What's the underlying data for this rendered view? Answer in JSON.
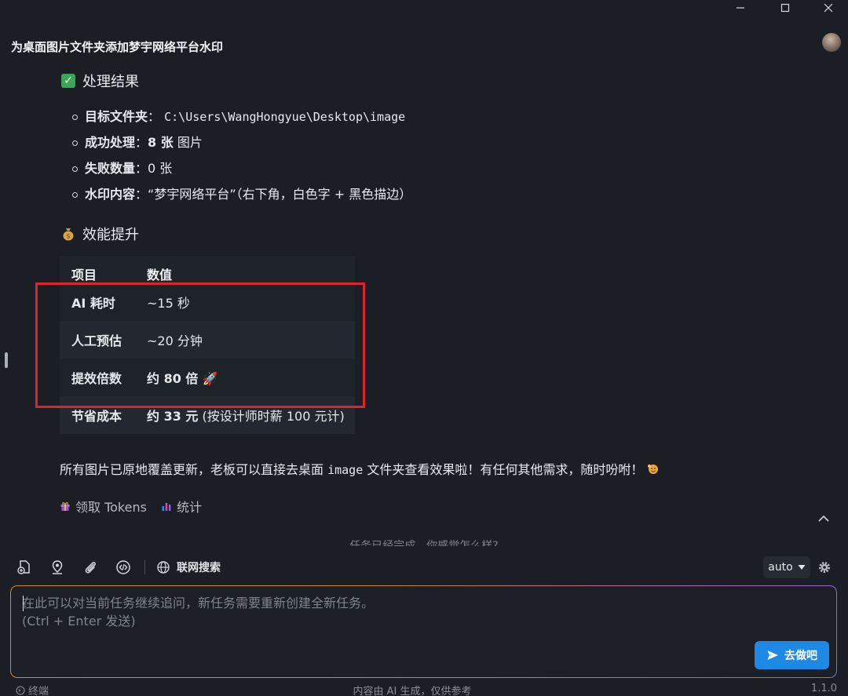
{
  "window": {
    "task_title": "为桌面图片文件夹添加梦宇网络平台水印"
  },
  "result": {
    "heading": "处理结果",
    "items": [
      {
        "label": "目标文件夹",
        "sep": "：",
        "value": "C:\\Users\\WangHongyue\\Desktop\\image"
      },
      {
        "label": "成功处理",
        "sep": "：",
        "value_bold": "8 张",
        "value": " 图片"
      },
      {
        "label": "失败数量",
        "sep": "：",
        "value": "0 张"
      },
      {
        "label": "水印内容",
        "sep": "：",
        "value": "“梦宇网络平台”（右下角，白色字 + 黑色描边）"
      }
    ]
  },
  "efficiency": {
    "heading": "效能提升",
    "columns": [
      "项目",
      "数值"
    ],
    "rows": [
      {
        "item": "AI 耗时",
        "value": "~15 秒"
      },
      {
        "item": "人工预估",
        "value": "~20 分钟"
      },
      {
        "item": "提效倍数",
        "value_bold": "约 80 倍",
        "emoji": "🚀"
      },
      {
        "item": "节省成本",
        "value_bold": "约 33 元",
        "value": " (按设计师时薪 100 元计)"
      }
    ]
  },
  "summary": {
    "before": "所有图片已原地覆盖更新，老板可以直接去桌面 ",
    "code": "image",
    "after": " 文件夹查看效果啦！有任何其他需求，随时吩咐！"
  },
  "actions": {
    "claim_tokens": "领取 Tokens",
    "stats": "统计"
  },
  "faded_prompt": "任务已经完成，你感觉怎么样?",
  "toolbar": {
    "web_search": "联网搜索",
    "model": "auto"
  },
  "input": {
    "placeholder": "在此可以对当前任务继续追问，新任务需要重新创建全新任务。\n(Ctrl + Enter 发送)",
    "value": "",
    "submit_label": "去做吧"
  },
  "statusbar": {
    "terminal": "终端",
    "disclaimer": "内容由 AI 生成，仅供参考",
    "version": "1.1.0"
  },
  "colors": {
    "background": "#1b1f25",
    "accent": "#1e88e5",
    "highlight": "#d8262c",
    "check": "#3aa757"
  }
}
